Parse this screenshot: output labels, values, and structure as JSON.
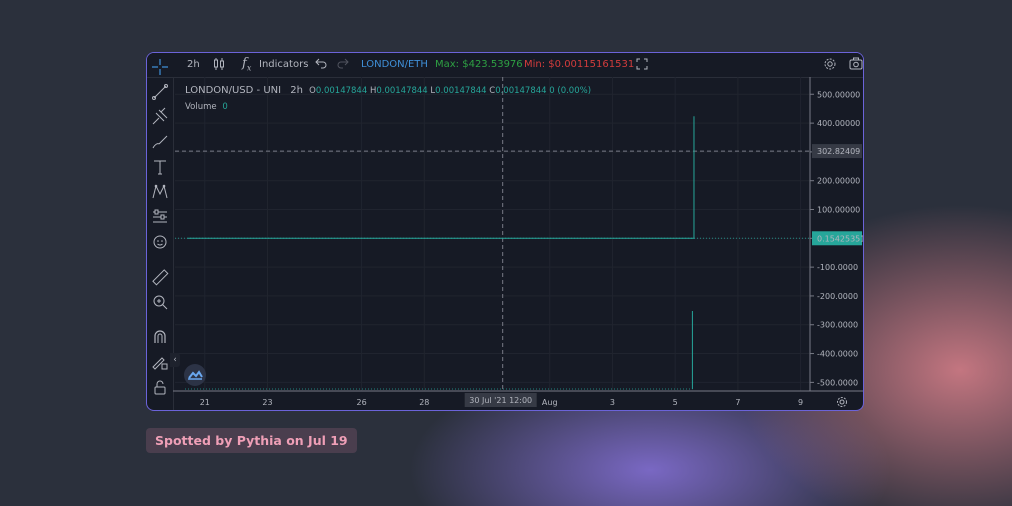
{
  "toolbar": {
    "interval": "2h",
    "fx_glyph": "f",
    "fx_sub": "x",
    "indicators": "Indicators",
    "pair": "LONDON/ETH",
    "max": "Max: $423.53976",
    "min": "Min: $0.00115161531"
  },
  "legend": {
    "title": "LONDON/USD - UNI",
    "interval": "2h",
    "o_label": "O",
    "o": "0.00147844",
    "h_label": "H",
    "h": "0.00147844",
    "l_label": "L",
    "l": "0.00147844",
    "c_label": "C",
    "c": "0.00147844",
    "change": "0 (0.00%)",
    "volume_label": "Volume",
    "volume": "0"
  },
  "colors": {
    "accent_border": "#6b63d9",
    "up": "#26a69a",
    "max_green": "#2ea043",
    "min_red": "#d33c3c",
    "pair_blue": "#3f8fd8",
    "background": "#161a25"
  },
  "chart_data": {
    "type": "line",
    "ytick_labels": [
      "500.00000",
      "400.00000",
      "300.00000",
      "200.00000",
      "100.00000",
      "0.00000",
      "-100.0000",
      "-200.0000",
      "-300.0000",
      "-400.0000",
      "-500.0000"
    ],
    "ytick_values": [
      500,
      400,
      300,
      200,
      100,
      0,
      -100,
      -200,
      -300,
      -400,
      -500
    ],
    "ylim": [
      -530,
      560
    ],
    "xticks": [
      {
        "label": "21",
        "t": 0
      },
      {
        "label": "23",
        "t": 2
      },
      {
        "label": "26",
        "t": 5
      },
      {
        "label": "28",
        "t": 7
      },
      {
        "label": "Aug",
        "t": 11
      },
      {
        "label": "3",
        "t": 13
      },
      {
        "label": "5",
        "t": 15
      },
      {
        "label": "7",
        "t": 17
      },
      {
        "label": "9",
        "t": 19
      }
    ],
    "xlim_days": [
      -0.95,
      19.3
    ],
    "series": [
      {
        "points": [
          [
            -0.55,
            0.15425351
          ],
          [
            15.6,
            0.15425351
          ],
          [
            15.6,
            423.53976
          ]
        ]
      }
    ],
    "volume_spike": {
      "t": 15.55
    },
    "crosshair": {
      "t": 9.5,
      "price": 302.82409,
      "price_label": "302.82409",
      "time_label": "30 Jul '21   12:00"
    },
    "last_price": {
      "price": 0.15425351,
      "label": "0.15425351"
    }
  },
  "watermark": {
    "brand_icon": "tradingview-logo-icon"
  },
  "footer": {
    "spotted": "Spotted by Pythia on Jul 19"
  }
}
